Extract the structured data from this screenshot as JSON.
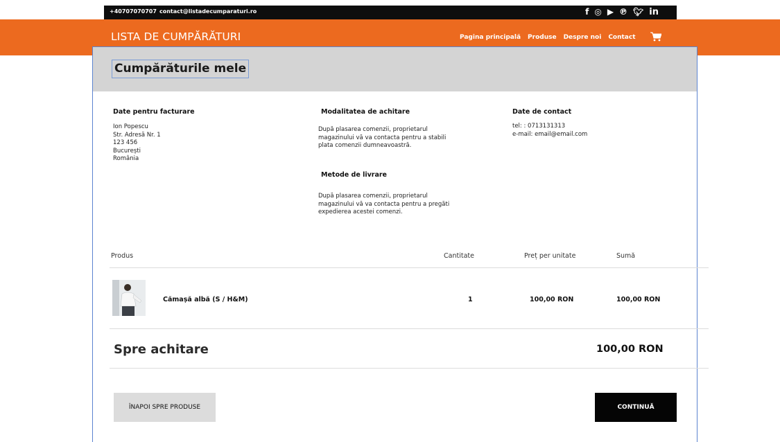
{
  "topbar": {
    "phone": "+40707070707",
    "email": "contact@listadecumparaturi.ro",
    "socials": [
      "facebook-icon",
      "instagram-icon",
      "youtube-icon",
      "pinterest-icon",
      "twitter-icon",
      "linkedin-icon"
    ]
  },
  "header": {
    "logo": "LISTA DE CUMPĂRĂTURI",
    "nav": [
      "Pagina principală",
      "Produse",
      "Despre noi",
      "Contact"
    ],
    "colors": {
      "accent": "#ec6a1f",
      "topbar": "#0e0e0e"
    }
  },
  "page": {
    "title": "Cumpărăturile mele"
  },
  "billing": {
    "heading": "Date pentru facturare",
    "lines": [
      "Ion Popescu",
      "Str. Adresă Nr. 1",
      "123 456",
      "București",
      "România"
    ]
  },
  "payment": {
    "heading": "Modalitatea de achitare",
    "lines": [
      "După plasarea comenzii, proprietarul",
      "magazinului vă va contacta pentru a stabili",
      "plata comenzii dumneavoastră."
    ]
  },
  "delivery": {
    "heading": "Metode de livrare",
    "lines": [
      "După plasarea comenzii, proprietarul",
      "magazinului vă va contacta pentru a pregăti",
      "expedierea acestei comenzi."
    ]
  },
  "contact": {
    "heading": "Date de contact",
    "phone": "tel: : 0713131313",
    "email": "e-mail: email@email.com"
  },
  "table": {
    "headers": [
      "Produs",
      "Cantitate",
      "Preț per unitate",
      "Sumă"
    ],
    "rows": [
      {
        "name": "Cămașă albă (S / H&M)",
        "quantity": "1",
        "unit_price": "100,00 RON",
        "sum": "100,00 RON"
      }
    ]
  },
  "summary": {
    "label": "Spre achitare",
    "total": "100,00 RON"
  },
  "actions": {
    "back": "ÎNAPOI SPRE PRODUSE",
    "next": "CONTINUĂ"
  }
}
